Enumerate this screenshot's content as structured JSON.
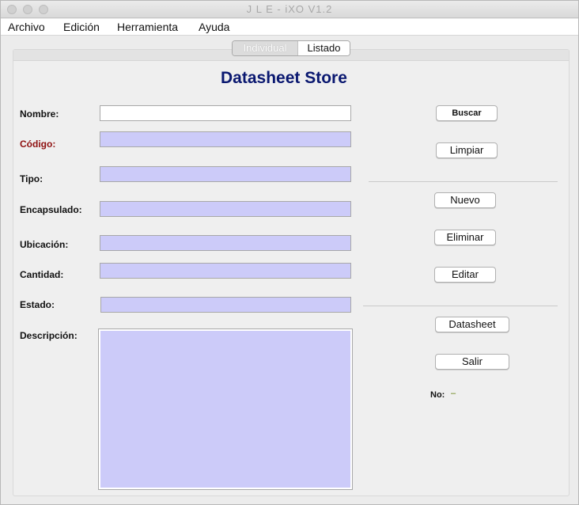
{
  "window": {
    "title": "J L E - iXO V1.2"
  },
  "menu": {
    "items": [
      "Archivo",
      "Edición",
      "Herramienta",
      "Ayuda"
    ]
  },
  "tabs": [
    {
      "label": "Individual",
      "active": true
    },
    {
      "label": "Listado",
      "active": false
    }
  ],
  "header": {
    "title": "Datasheet Store"
  },
  "form": {
    "labels": {
      "nombre": "Nombre:",
      "codigo": "Código:",
      "tipo": "Tipo:",
      "encapsulado": "Encapsulado:",
      "ubicacion": "Ubicación:",
      "cantidad": "Cantidad:",
      "estado": "Estado:",
      "descripcion": "Descripción:"
    },
    "values": {
      "nombre": "",
      "codigo": "",
      "tipo": "",
      "encapsulado": "",
      "ubicacion": "",
      "cantidad": "",
      "estado": "",
      "descripcion": ""
    }
  },
  "buttons": {
    "buscar": "Buscar",
    "limpiar": "Limpiar",
    "nuevo": "Nuevo",
    "eliminar": "Eliminar",
    "editar": "Editar",
    "datasheet": "Datasheet",
    "salir": "Salir"
  },
  "status": {
    "no_label": "No:",
    "no_value": "–"
  },
  "colors": {
    "field_bg": "#cccbf9",
    "title": "#0a1870",
    "codigo_label": "#8e1010"
  }
}
